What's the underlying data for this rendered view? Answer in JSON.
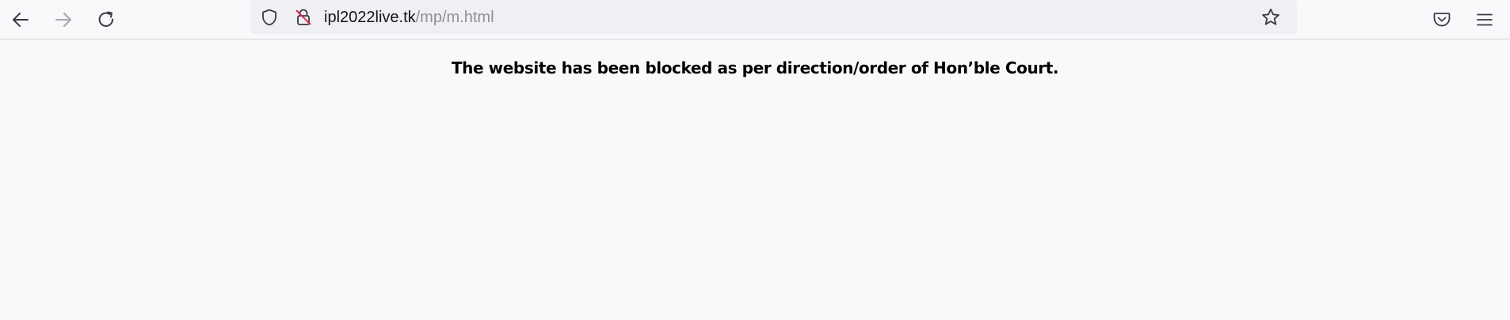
{
  "browser": {
    "nav": {
      "back_icon": "arrow-left-icon",
      "forward_icon": "arrow-right-icon",
      "reload_icon": "reload-icon"
    },
    "urlbar": {
      "shield_icon": "tracking-protection-shield-icon",
      "lock_icon": "insecure-lock-icon",
      "host": "ipl2022live.tk",
      "path": "/mp/m.html",
      "bookmark_icon": "star-icon"
    },
    "toolbar_right": {
      "pocket_icon": "pocket-icon",
      "menu_icon": "hamburger-menu-icon"
    }
  },
  "page": {
    "message": "The website has been blocked as per direction/order of Hon’ble Court."
  },
  "colors": {
    "toolbar_bg": "#f9f9fb",
    "urlbar_bg": "#f0f0f4",
    "url_host": "#15141a",
    "url_path": "#8f8f9d",
    "insecure_slash": "#e22850"
  }
}
